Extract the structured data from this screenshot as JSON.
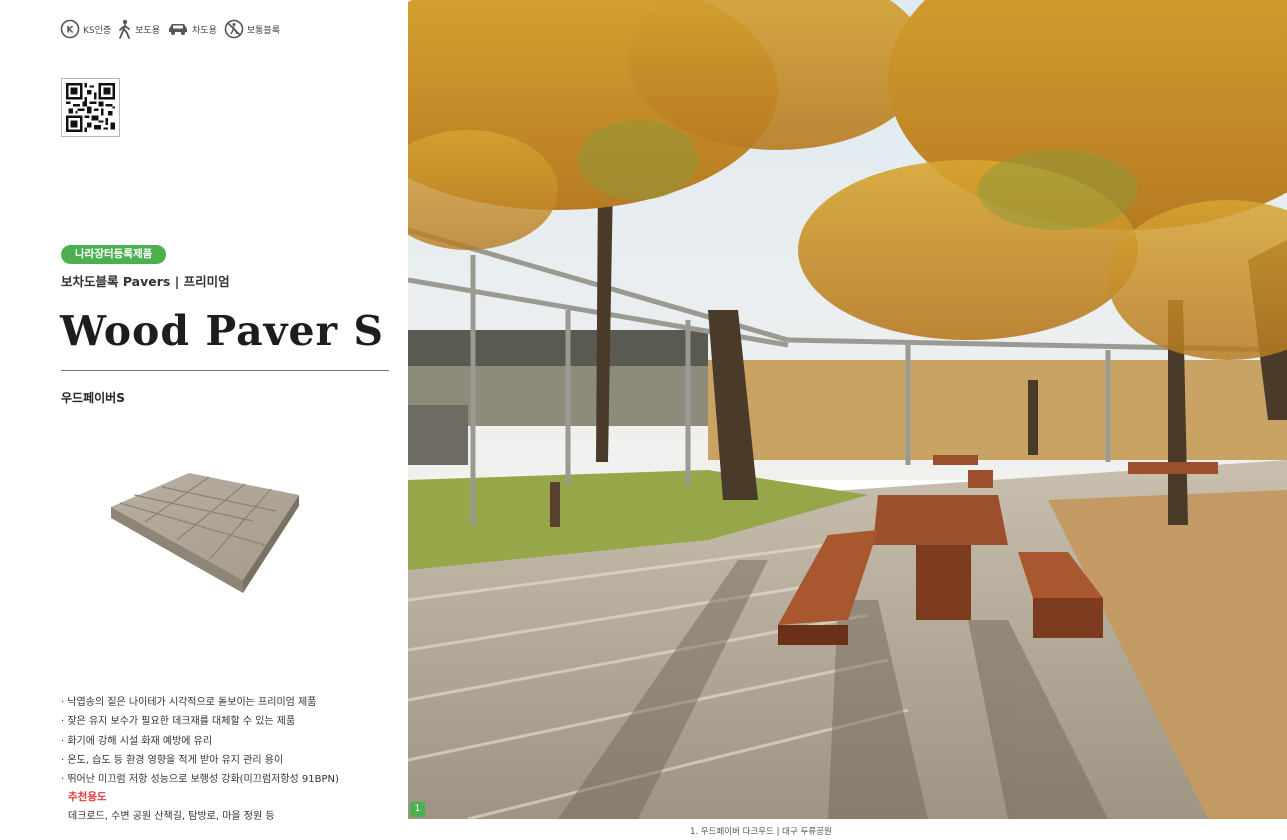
{
  "certifications": [
    {
      "icon": "ks-mark-icon",
      "label": "KS인증"
    },
    {
      "icon": "pedestrian-icon",
      "label": "보도용"
    },
    {
      "icon": "car-icon",
      "label": "차도용"
    },
    {
      "icon": "no-pedestrian-icon",
      "label": "보통블록"
    }
  ],
  "badge": "나라장터등록제품",
  "category": "보차도블록 Pavers | 프리미엄",
  "title": "Wood Paver S",
  "subtitle": "우드페이버S",
  "features": [
    "낙엽송의 짙은 나이테가 시각적으로 돋보이는 프리미엄 제품",
    "잦은 유지 보수가 필요한 데크재를 대체할 수 있는 제품",
    "화기에 강해 시설 화재 예방에 유리",
    "온도, 습도 등 환경 영향을 적게 받아 유지 관리 용이",
    "뛰어난 미끄럼 저항 성능으로 보행성 강화(미끄럼저항성 91BPN)"
  ],
  "usage": {
    "label": "추천용도",
    "text": "데크로드, 수변 공원 산책길, 탐방로, 마을 정원 등"
  },
  "photo": {
    "number": "1",
    "caption": "1. 우드페이버 다크우드 | 대구 두류공원"
  },
  "colors": {
    "accent_green": "#4caf50",
    "usage_red": "#e53935"
  }
}
